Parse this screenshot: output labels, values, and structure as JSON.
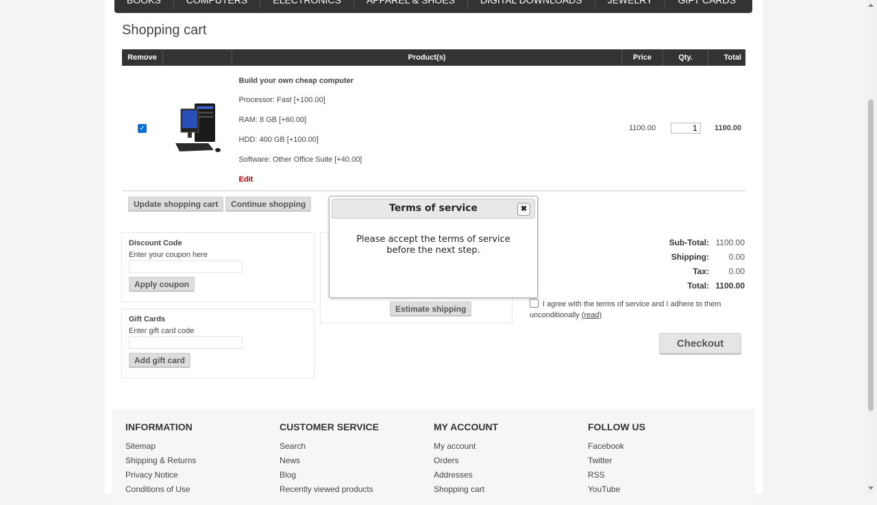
{
  "nav": {
    "items": [
      "BOOKS",
      "COMPUTERS",
      "ELECTRONICS",
      "APPAREL & SHOES",
      "DIGITAL DOWNLOADS",
      "JEWELRY",
      "GIFT CARDS"
    ]
  },
  "page_title": "Shopping cart",
  "cart": {
    "headers": {
      "remove": "Remove",
      "product": "Product(s)",
      "price": "Price",
      "qty": "Qty.",
      "total": "Total"
    },
    "item": {
      "name": "Build your own cheap computer",
      "attributes": [
        "Processor: Fast [+100.00]",
        "RAM: 8 GB [+60.00]",
        "HDD: 400 GB [+100.00]",
        "Software: Other Office Suite [+40.00]"
      ],
      "edit_label": "Edit",
      "price": "1100.00",
      "qty": "1",
      "total": "1100.00"
    }
  },
  "buttons": {
    "update_cart": "Update shopping cart",
    "continue_shopping": "Continue shopping",
    "apply_coupon": "Apply coupon",
    "add_gift_card": "Add gift card",
    "estimate_shipping": "Estimate shipping",
    "checkout": "Checkout"
  },
  "discount": {
    "title": "Discount Code",
    "hint": "Enter your coupon here"
  },
  "giftcard": {
    "title": "Gift Cards",
    "hint": "Enter gift card code"
  },
  "totals": {
    "subtotal_label": "Sub-Total:",
    "subtotal": "1100.00",
    "shipping_label": "Shipping:",
    "shipping": "0.00",
    "tax_label": "Tax:",
    "tax": "0.00",
    "total_label": "Total:",
    "total": "1100.00"
  },
  "terms": {
    "text": "I agree with the terms of service and I adhere to them unconditionally",
    "read_link": "(read)"
  },
  "modal": {
    "title": "Terms of service",
    "message": "Please accept the terms of service before the next step."
  },
  "footer": {
    "columns": [
      {
        "title": "INFORMATION",
        "links": [
          "Sitemap",
          "Shipping & Returns",
          "Privacy Notice",
          "Conditions of Use"
        ]
      },
      {
        "title": "CUSTOMER SERVICE",
        "links": [
          "Search",
          "News",
          "Blog",
          "Recently viewed products"
        ]
      },
      {
        "title": "MY ACCOUNT",
        "links": [
          "My account",
          "Orders",
          "Addresses",
          "Shopping cart"
        ]
      },
      {
        "title": "FOLLOW US",
        "links": [
          "Facebook",
          "Twitter",
          "RSS",
          "YouTube"
        ]
      }
    ]
  },
  "colors": {
    "header_bg": "#333333",
    "total_green": "#1a7d1a",
    "edit_red": "#aa0000"
  }
}
